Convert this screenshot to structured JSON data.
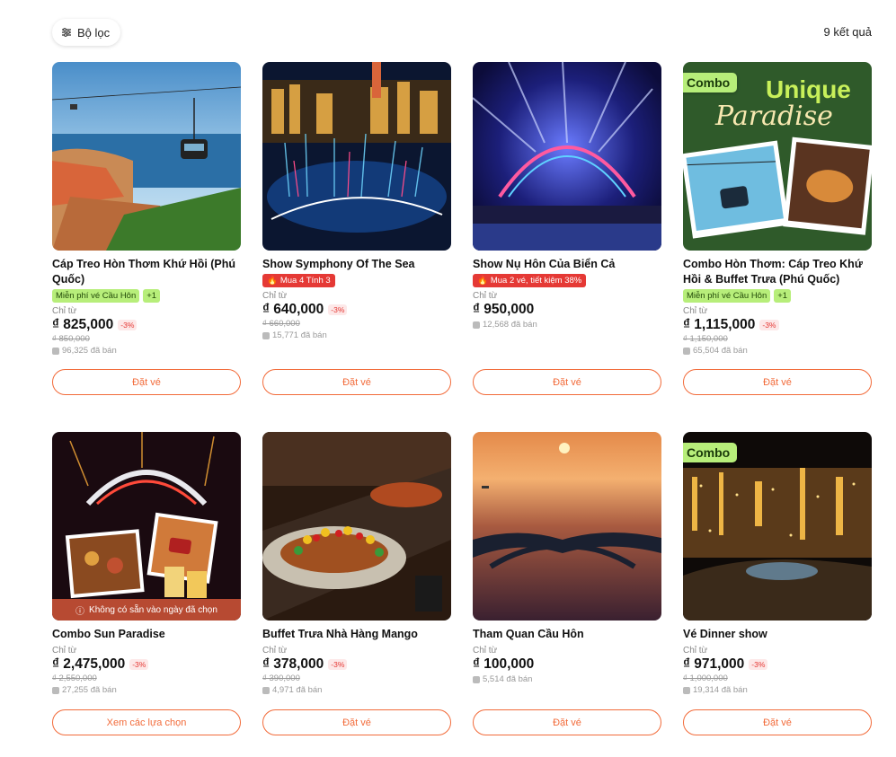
{
  "toolbar": {
    "filter_label": "Bộ lọc",
    "result_count": "9 kết quả"
  },
  "colors": {
    "accent": "#f26b3a",
    "green_badge": "#b7ee7a",
    "red_badge": "#e53935"
  },
  "cards": [
    {
      "title": "Cáp Treo Hòn Thơm Khứ Hồi (Phú Quốc)",
      "combo": "",
      "badge_green": "Miễn phí vé Cầu Hôn",
      "badge_plus": "+1",
      "badge_red": "",
      "from_label": "Chỉ từ",
      "price": "₫ 825,000",
      "discount": "-3%",
      "old_price": "₫ 850,000",
      "sold": "96,325 đã bán",
      "button": "Đặt vé",
      "unavailable": ""
    },
    {
      "title": "Show Symphony Of The Sea",
      "combo": "",
      "badge_green": "",
      "badge_plus": "",
      "badge_red": "Mua 4 Tính 3",
      "from_label": "Chỉ từ",
      "price": "₫ 640,000",
      "discount": "-3%",
      "old_price": "₫ 660,000",
      "sold": "15,771 đã bán",
      "button": "Đặt vé",
      "unavailable": ""
    },
    {
      "title": "Show Nụ Hôn Của Biển Cả",
      "combo": "",
      "badge_green": "",
      "badge_plus": "",
      "badge_red": "Mua 2 vé, tiết kiệm 38%",
      "from_label": "Chỉ từ",
      "price": "₫ 950,000",
      "discount": "",
      "old_price": "",
      "sold": "12,568 đã bán",
      "button": "Đặt vé",
      "unavailable": ""
    },
    {
      "title": "Combo Hòn Thơm: Cáp Treo Khứ Hồi & Buffet Trưa (Phú Quốc)",
      "combo": "Combo",
      "badge_green": "Miễn phí vé Cầu Hôn",
      "badge_plus": "+1",
      "badge_red": "",
      "from_label": "Chỉ từ",
      "price": "₫ 1,115,000",
      "discount": "-3%",
      "old_price": "₫ 1,150,000",
      "sold": "65,504 đã bán",
      "button": "Đặt vé",
      "unavailable": "",
      "art_title": "Unique",
      "art_script": "Paradise"
    },
    {
      "title": "Combo Sun Paradise",
      "combo": "",
      "badge_green": "",
      "badge_plus": "",
      "badge_red": "",
      "from_label": "Chỉ từ",
      "price": "₫ 2,475,000",
      "discount": "-3%",
      "old_price": "₫ 2,550,000",
      "sold": "27,255 đã bán",
      "button": "Xem các lựa chọn",
      "unavailable": "Không có sẵn vào ngày đã chọn"
    },
    {
      "title": "Buffet Trưa Nhà Hàng Mango",
      "combo": "",
      "badge_green": "",
      "badge_plus": "",
      "badge_red": "",
      "from_label": "Chỉ từ",
      "price": "₫ 378,000",
      "discount": "-3%",
      "old_price": "₫ 390,000",
      "sold": "4,971 đã bán",
      "button": "Đặt vé",
      "unavailable": ""
    },
    {
      "title": "Tham Quan Cầu Hôn",
      "combo": "",
      "badge_green": "",
      "badge_plus": "",
      "badge_red": "",
      "from_label": "Chỉ từ",
      "price": "₫ 100,000",
      "discount": "",
      "old_price": "",
      "sold": "5,514 đã bán",
      "button": "Đặt vé",
      "unavailable": ""
    },
    {
      "title": "Vé Dinner show",
      "combo": "Combo",
      "badge_green": "",
      "badge_plus": "",
      "badge_red": "",
      "from_label": "Chỉ từ",
      "price": "₫ 971,000",
      "discount": "-3%",
      "old_price": "₫ 1,000,000",
      "sold": "19,314 đã bán",
      "button": "Đặt vé",
      "unavailable": ""
    }
  ]
}
